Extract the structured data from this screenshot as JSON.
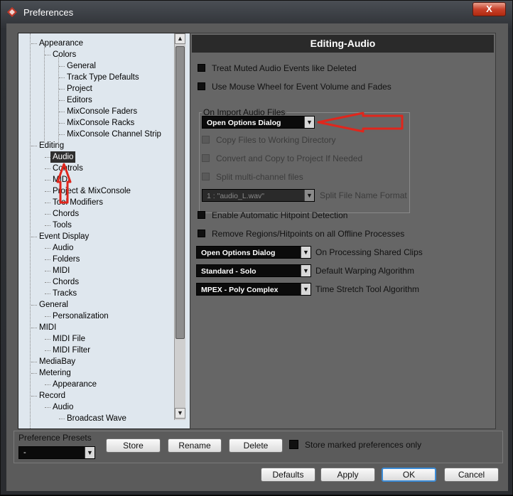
{
  "window": {
    "title": "Preferences",
    "close_label": "X"
  },
  "tree": {
    "items": [
      {
        "label": "Appearance",
        "level": 1
      },
      {
        "label": "Colors",
        "level": 2
      },
      {
        "label": "General",
        "level": 3
      },
      {
        "label": "Track Type Defaults",
        "level": 3
      },
      {
        "label": "Project",
        "level": 3
      },
      {
        "label": "Editors",
        "level": 3
      },
      {
        "label": "MixConsole Faders",
        "level": 3
      },
      {
        "label": "MixConsole Racks",
        "level": 3
      },
      {
        "label": "MixConsole Channel Strip",
        "level": 3
      },
      {
        "label": "Editing",
        "level": 1
      },
      {
        "label": "Audio",
        "level": 2,
        "selected": true
      },
      {
        "label": "Controls",
        "level": 2
      },
      {
        "label": "MIDI",
        "level": 2
      },
      {
        "label": "Project & MixConsole",
        "level": 2
      },
      {
        "label": "Tool Modifiers",
        "level": 2
      },
      {
        "label": "Chords",
        "level": 2
      },
      {
        "label": "Tools",
        "level": 2
      },
      {
        "label": "Event Display",
        "level": 1
      },
      {
        "label": "Audio",
        "level": 2
      },
      {
        "label": "Folders",
        "level": 2
      },
      {
        "label": "MIDI",
        "level": 2
      },
      {
        "label": "Chords",
        "level": 2
      },
      {
        "label": "Tracks",
        "level": 2
      },
      {
        "label": "General",
        "level": 1
      },
      {
        "label": "Personalization",
        "level": 2
      },
      {
        "label": "MIDI",
        "level": 1
      },
      {
        "label": "MIDI File",
        "level": 2
      },
      {
        "label": "MIDI Filter",
        "level": 2
      },
      {
        "label": "MediaBay",
        "level": 1
      },
      {
        "label": "Metering",
        "level": 1
      },
      {
        "label": "Appearance",
        "level": 2
      },
      {
        "label": "Record",
        "level": 1
      },
      {
        "label": "Audio",
        "level": 2
      },
      {
        "label": "Broadcast Wave",
        "level": 3
      }
    ]
  },
  "panel": {
    "title": "Editing-Audio",
    "checkboxes": {
      "treat_muted": "Treat Muted Audio Events like Deleted",
      "mouse_wheel": "Use Mouse Wheel for Event Volume and Fades",
      "hitpoint": "Enable Automatic Hitpoint Detection",
      "remove_regions": "Remove Regions/Hitpoints on all Offline Processes"
    },
    "import_group": {
      "label": "On Import Audio Files",
      "dropdown_value": "Open Options Dialog",
      "copy_files": "Copy Files to Working Directory",
      "convert_copy": "Convert and Copy to Project If Needed",
      "split_multi": "Split multi-channel files",
      "split_format_value": "1 : \"audio_L.wav\"",
      "split_format_label": "Split File Name Format"
    },
    "shared_clips": {
      "value": "Open Options Dialog",
      "label": "On Processing Shared Clips"
    },
    "warping": {
      "value": "Standard - Solo",
      "label": "Default Warping Algorithm"
    },
    "time_stretch": {
      "value": "MPEX - Poly Complex",
      "label": "Time Stretch Tool Algorithm"
    }
  },
  "presets": {
    "label": "Preference Presets",
    "value": "-",
    "store": "Store",
    "rename": "Rename",
    "delete": "Delete",
    "store_marked": "Store marked preferences only"
  },
  "footer": {
    "defaults": "Defaults",
    "apply": "Apply",
    "ok": "OK",
    "cancel": "Cancel"
  },
  "colors": {
    "annotation_red": "#e0261c",
    "selection": "#2e2e2e",
    "tree_bg": "#dfe7ee"
  }
}
